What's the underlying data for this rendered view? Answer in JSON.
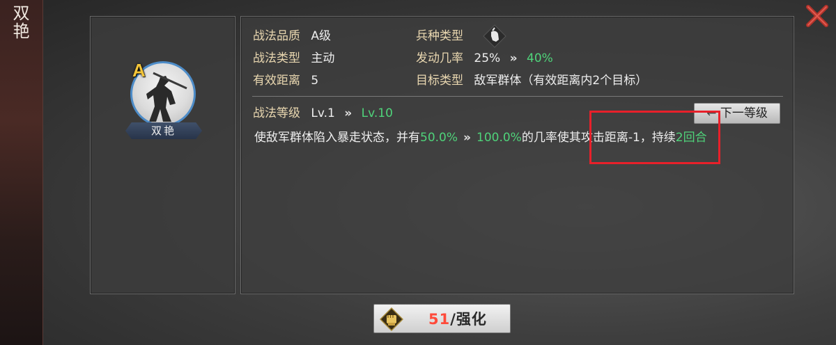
{
  "side": {
    "title": "双艳"
  },
  "close": {
    "icon": "close-x-icon"
  },
  "card": {
    "grade": "A",
    "name": "双艳"
  },
  "info": {
    "quality_label": "战法品质",
    "quality_value": "A级",
    "troop_label": "兵种类型",
    "troop_icon": "troop-type-icon",
    "type_label": "战法类型",
    "type_value": "主动",
    "rate_label": "发动几率",
    "rate_from": "25%",
    "rate_arrows": "»",
    "rate_to": "40%",
    "range_label": "有效距离",
    "range_value": "5",
    "target_label": "目标类型",
    "target_value": "敌军群体（有效距离内2个目标）"
  },
  "level": {
    "label": "战法等级",
    "from": "Lv.1",
    "arrows": "»",
    "to": "Lv.10",
    "next_button": "下一等级"
  },
  "description": {
    "part1": "使敌军群体陷入暴走状态，并有",
    "p_from": "50.0%",
    "arrows": "»",
    "p_to": "100.0%",
    "part2": "的几率使其攻击距离-1，持续",
    "turns": "2回合"
  },
  "enhance": {
    "count": "51",
    "label": "/强化",
    "icon": "fist-icon"
  },
  "colors": {
    "green": "#4fd37a",
    "label": "#e9d7b0",
    "highlight": "#e8202a",
    "count": "#ff4a3a"
  }
}
